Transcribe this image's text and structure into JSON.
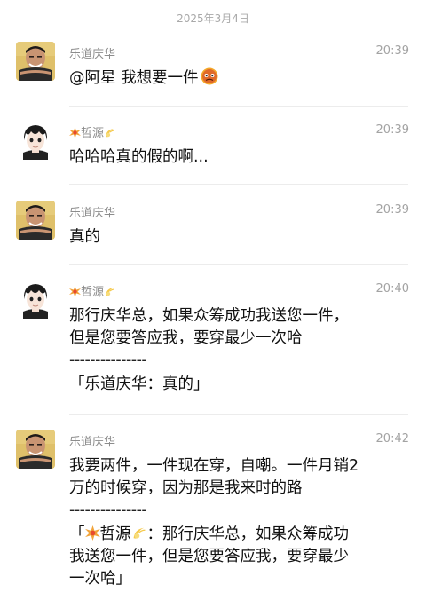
{
  "date_separator": "2025年3月4日",
  "messages": [
    {
      "sender": "乐道庆华",
      "time": "20:39",
      "lines": [
        "@阿星 我想要一件"
      ]
    },
    {
      "sender": "哲源",
      "time": "20:39",
      "lines": [
        "哈哈哈真的假的啊..."
      ]
    },
    {
      "sender": "乐道庆华",
      "time": "20:39",
      "lines": [
        "真的"
      ]
    },
    {
      "sender": "哲源",
      "time": "20:40",
      "lines": [
        "那行庆华总，如果众筹成功我送您一件，",
        "但是您要答应我，要穿最少一次哈"
      ],
      "quote_sep": "---------------",
      "quote": "「乐道庆华：真的」"
    },
    {
      "sender": "乐道庆华",
      "time": "20:42",
      "lines": [
        "我要两件，一件现在穿，自嘲。一件月销2",
        "万的时候穿，因为那是我来时的路"
      ],
      "quote_sep": "---------------",
      "quote_open": "「",
      "quote_sender": "哲源",
      "quote_line1": "：那行庆华总，如果众筹成功",
      "quote_line2": "我送您一件，但是您要答应我，要穿最少",
      "quote_line3": "一次哈」"
    }
  ],
  "icons": {
    "sender_prefix": "burst-emoji",
    "sender_suffix": "comet-emoji",
    "message_end": "angry-face-emoji"
  }
}
